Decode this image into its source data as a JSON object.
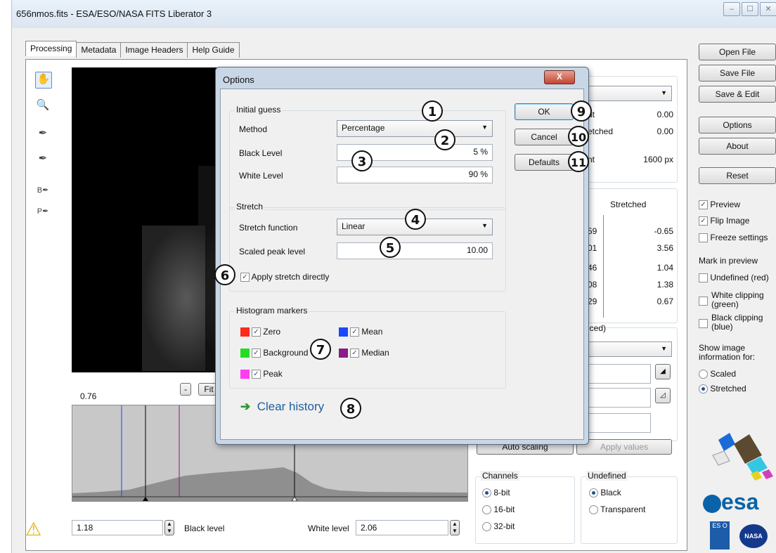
{
  "window": {
    "title": "656nmos.fits - ESA/ESO/NASA FITS Liberator 3",
    "minimize": "–",
    "maximize": "☐",
    "close": "✕"
  },
  "tabs": [
    "Processing",
    "Metadata",
    "Image Headers",
    "Help Guide"
  ],
  "tools": {
    "hand": "✋",
    "zoom": "🔍",
    "eyedropper": "✒",
    "eyedropper_b": "B",
    "eyedropper_p": "P"
  },
  "preview": {
    "zoom_minus": "-",
    "fit_label": "Fit",
    "value": "0.76"
  },
  "histogram": {
    "black_value": "1.18",
    "black_label": "Black level",
    "white_label": "White level",
    "white_value": "2.06"
  },
  "right_buttons": {
    "open_file": "Open File",
    "save_file": "Save File",
    "save_edit": "Save & Edit",
    "options": "Options",
    "about": "About",
    "reset": "Reset"
  },
  "right_checks": {
    "preview": "Preview",
    "flip": "Flip Image",
    "freeze": "Freeze settings",
    "mark_title": "Mark in preview",
    "undefined": "Undefined (red)",
    "white_clip": "White clipping",
    "white_clip2": "(green)",
    "black_clip": "Black clipping",
    "black_clip2": "(blue)",
    "show_info": "Show image",
    "show_info2": "information for:",
    "scaled": "Scaled",
    "stretched": "Stretched"
  },
  "stats": {
    "row1_label": "ut",
    "row1_value": "0.00",
    "row2_label": "etched",
    "row2_value": "0.00",
    "row3_label": "nt",
    "row3_value": "1600 px",
    "col_header": "Stretched",
    "rows": [
      {
        "left": "59",
        "value": "-0.65"
      },
      {
        "left": "01",
        "value": "3.56"
      },
      {
        "left": "46",
        "value": "1.04"
      },
      {
        "left": "08",
        "value": "1.38"
      },
      {
        "left": "29",
        "value": "0.67"
      }
    ],
    "ced_label": "iced)"
  },
  "scaling": {
    "auto": "Auto scaling",
    "apply": "Apply values"
  },
  "channels": {
    "title": "Channels",
    "opt1": "8-bit",
    "opt2": "16-bit",
    "opt3": "32-bit"
  },
  "undefined": {
    "title": "Undefined",
    "opt1": "Black",
    "opt2": "Transparent"
  },
  "logos": {
    "esa": "esa",
    "eso": "ES O",
    "nasa": "NASA"
  },
  "dialog": {
    "title": "Options",
    "close": "X",
    "initial_guess": "Initial guess",
    "method_label": "Method",
    "method_value": "Percentage",
    "black_level_label": "Black Level",
    "black_level_value": "5 %",
    "white_level_label": "White Level",
    "white_level_value": "90 %",
    "stretch": "Stretch",
    "stretch_function_label": "Stretch function",
    "stretch_function_value": "Linear",
    "scaled_peak_label": "Scaled peak level",
    "scaled_peak_value": "10.00",
    "apply_stretch": "Apply stretch directly",
    "histogram_markers": "Histogram markers",
    "markers": {
      "zero": "Zero",
      "mean": "Mean",
      "background": "Background",
      "median": "Median",
      "peak": "Peak"
    },
    "marker_colors": {
      "zero": "#ff2a1a",
      "mean": "#1a47ff",
      "background": "#22dd22",
      "median": "#8a1a8a",
      "peak": "#ff3cf0"
    },
    "clear_history": "Clear history",
    "ok": "OK",
    "cancel": "Cancel",
    "defaults": "Defaults"
  },
  "callouts": [
    "1",
    "2",
    "3",
    "4",
    "5",
    "6",
    "7",
    "8",
    "9",
    "10",
    "11"
  ],
  "warning_icon": "⚠"
}
